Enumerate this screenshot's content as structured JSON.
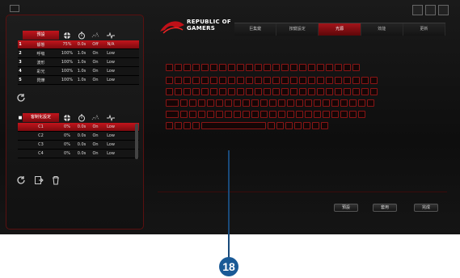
{
  "app": {
    "brand_line1": "REPUBLIC OF",
    "brand_line2": "GAMERS"
  },
  "nav": {
    "tabs": [
      "巨集鍵",
      "按鍵設定",
      "光源",
      "效能",
      "更新"
    ],
    "active": 2
  },
  "left_top": {
    "header": {
      "name": "預設",
      "icons": [
        "crosshair-icon",
        "timer-icon",
        "sparkle-icon",
        "pulse-icon"
      ]
    },
    "rows": [
      {
        "num": "1",
        "name": "靜態",
        "a": "75%",
        "b": "0.0s",
        "c": "Off",
        "d": "N/A",
        "selected": true
      },
      {
        "num": "2",
        "name": "呼吸",
        "a": "100%",
        "b": "1.0s",
        "c": "On",
        "d": "Low",
        "selected": false
      },
      {
        "num": "3",
        "name": "波形",
        "a": "100%",
        "b": "1.0s",
        "c": "On",
        "d": "Low",
        "selected": false
      },
      {
        "num": "4",
        "name": "彩光",
        "a": "100%",
        "b": "1.0s",
        "c": "On",
        "d": "Low",
        "selected": false
      },
      {
        "num": "5",
        "name": "閃爍",
        "a": "100%",
        "b": "1.0s",
        "c": "On",
        "d": "Low",
        "selected": false
      }
    ]
  },
  "left_bottom": {
    "header": {
      "name": "客制化設定"
    },
    "rows": [
      {
        "name": "C1",
        "a": "0%",
        "b": "0.0s",
        "c": "On",
        "d": "Low",
        "selected": true
      },
      {
        "name": "C2",
        "a": "0%",
        "b": "0.0s",
        "c": "On",
        "d": "Low",
        "selected": false
      },
      {
        "name": "C3",
        "a": "0%",
        "b": "0.0s",
        "c": "On",
        "d": "Low",
        "selected": false
      },
      {
        "name": "C4",
        "a": "0%",
        "b": "0.0s",
        "c": "On",
        "d": "Low",
        "selected": false
      }
    ]
  },
  "buttons": {
    "reset": "預設",
    "apply": "套用",
    "done": "完成"
  },
  "callout": {
    "label": "18"
  }
}
